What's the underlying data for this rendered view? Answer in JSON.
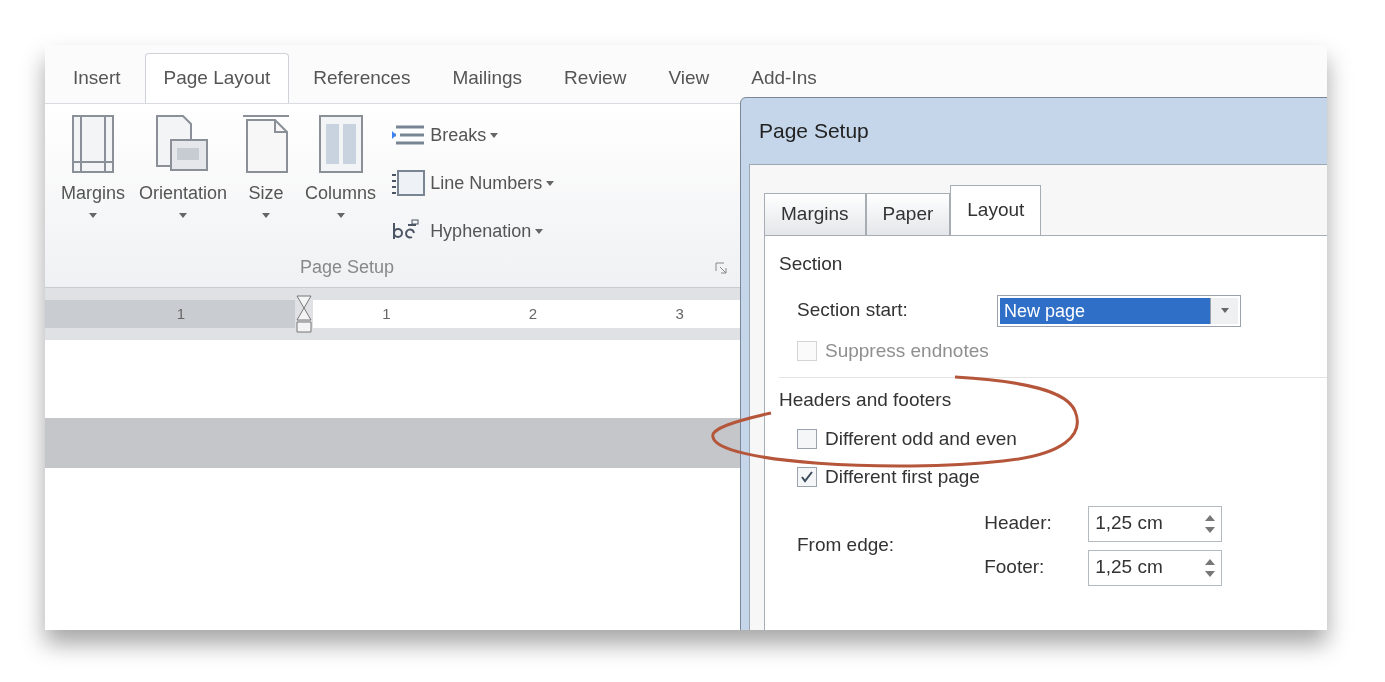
{
  "ribbon": {
    "tabs": [
      {
        "label": "Insert",
        "selected": false
      },
      {
        "label": "Page Layout",
        "selected": true
      },
      {
        "label": "References",
        "selected": false
      },
      {
        "label": "Mailings",
        "selected": false
      },
      {
        "label": "Review",
        "selected": false
      },
      {
        "label": "View",
        "selected": false
      },
      {
        "label": "Add-Ins",
        "selected": false
      }
    ],
    "big_buttons": [
      {
        "label": "Margins",
        "kind": "margins"
      },
      {
        "label": "Orientation",
        "kind": "orientation"
      },
      {
        "label": "Size",
        "kind": "size"
      },
      {
        "label": "Columns",
        "kind": "columns"
      }
    ],
    "small_buttons": [
      {
        "label": "Breaks",
        "kind": "breaks"
      },
      {
        "label": "Line Numbers",
        "kind": "line-numbers"
      },
      {
        "label": "Hyphenation",
        "kind": "hyphenation"
      }
    ],
    "group_label": "Page Setup"
  },
  "ruler": {
    "numbers": [
      "1",
      "1",
      "2",
      "3"
    ]
  },
  "dialog": {
    "title": "Page Setup",
    "tabs": [
      {
        "label": "Margins",
        "selected": false
      },
      {
        "label": "Paper",
        "selected": false
      },
      {
        "label": "Layout",
        "selected": true
      }
    ],
    "section": {
      "heading": "Section",
      "start_label": "Section start:",
      "start_value": "New page",
      "options": [
        {
          "label": "Suppress endnotes",
          "checked": false,
          "disabled": true
        }
      ]
    },
    "headers_footers": {
      "heading": "Headers and footers",
      "options": [
        {
          "label": "Different odd and even",
          "checked": false,
          "disabled": false
        },
        {
          "label": "Different first page",
          "checked": true,
          "disabled": false
        }
      ],
      "from_edge_label": "From edge:",
      "fields": [
        {
          "label": "Header:",
          "value": "1,25 cm"
        },
        {
          "label": "Footer:",
          "value": "1,25 cm"
        }
      ]
    }
  }
}
